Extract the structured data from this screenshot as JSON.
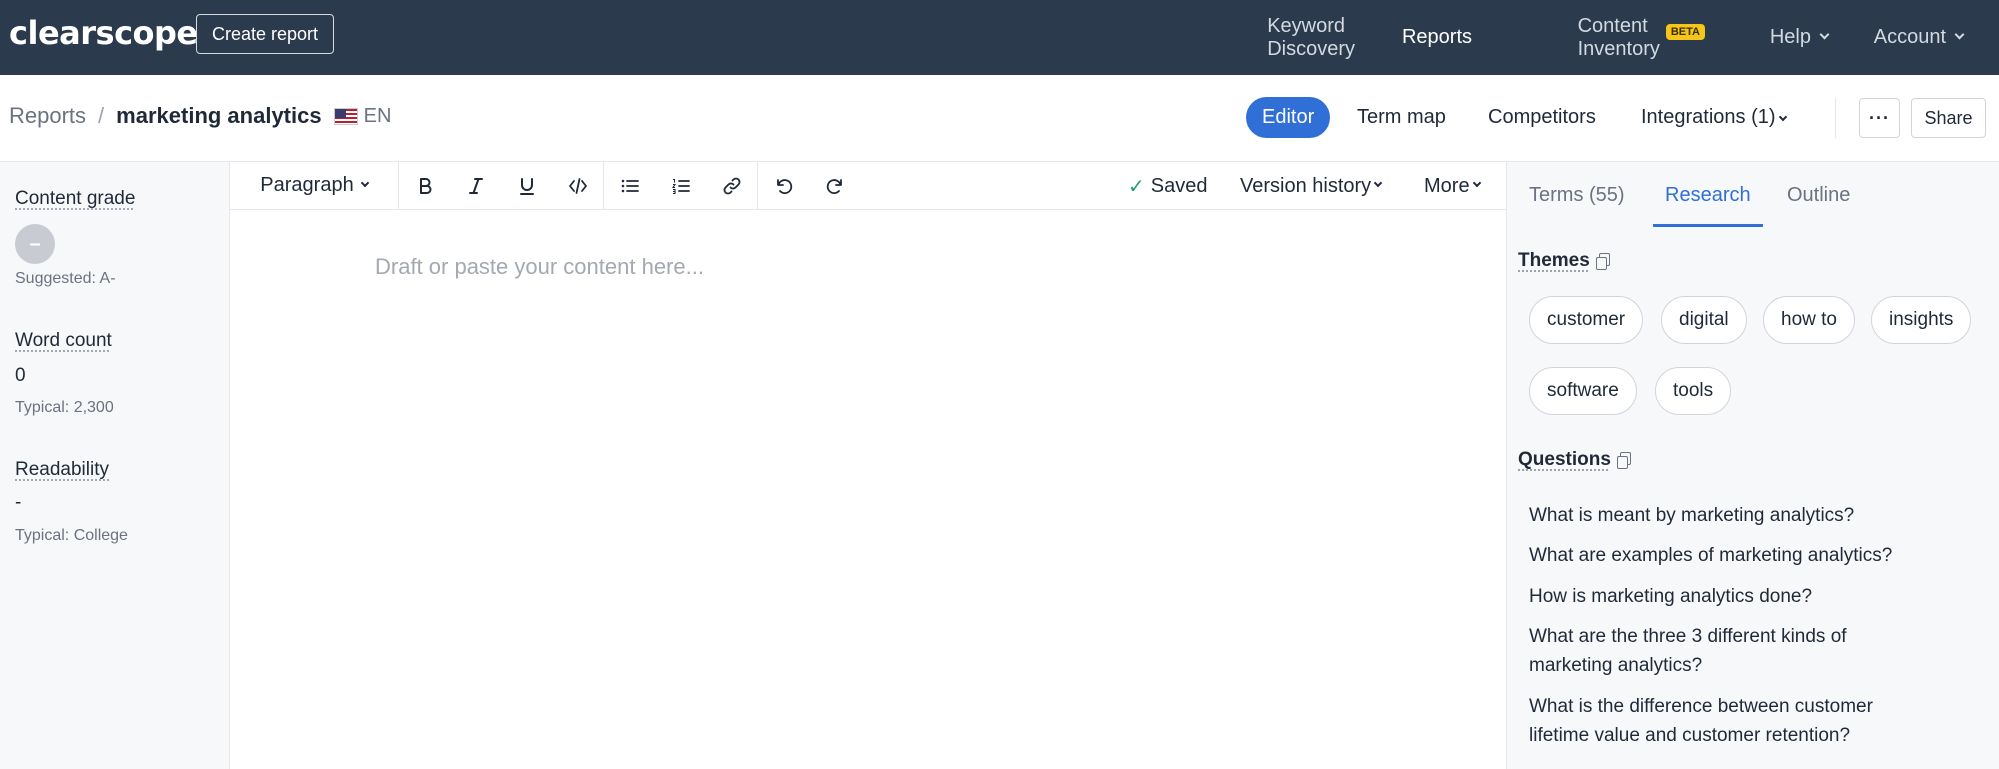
{
  "nav": {
    "logo": "clearscope",
    "create_report": "Create report",
    "links": {
      "keyword_discovery": "Keyword Discovery",
      "reports": "Reports",
      "content_inventory": "Content Inventory",
      "beta": "BETA",
      "help": "Help",
      "account": "Account"
    }
  },
  "breadcrumb": {
    "root": "Reports",
    "separator": "/",
    "current": "marketing analytics",
    "language": "EN"
  },
  "view_tabs": {
    "editor": "Editor",
    "term_map": "Term map",
    "competitors": "Competitors",
    "integrations": "Integrations (1)"
  },
  "actions": {
    "more": "···",
    "share": "Share"
  },
  "left_panel": {
    "content_grade": {
      "title": "Content grade",
      "value": "–",
      "suggested": "Suggested: A-"
    },
    "word_count": {
      "title": "Word count",
      "value": "0",
      "typical": "Typical: 2,300"
    },
    "readability": {
      "title": "Readability",
      "value": "-",
      "typical": "Typical: College"
    }
  },
  "toolbar": {
    "paragraph": "Paragraph",
    "saved": "Saved",
    "version_history": "Version history",
    "more": "More"
  },
  "editor": {
    "placeholder": "Draft or paste your content here..."
  },
  "right_panel": {
    "tabs": {
      "terms": "Terms (55)",
      "research": "Research",
      "outline": "Outline"
    },
    "themes_title": "Themes",
    "themes": [
      "customer",
      "digital",
      "how to",
      "insights",
      "software",
      "tools"
    ],
    "questions_title": "Questions",
    "questions": [
      "What is meant by marketing analytics?",
      "What are examples of marketing analytics?",
      "How is marketing analytics done?",
      "What are the three 3 different kinds of marketing analytics?",
      "What is the difference between customer lifetime value and customer retention?"
    ]
  },
  "colors": {
    "nav_bg": "#2b3a4c",
    "accent": "#2f6fd6",
    "beta_badge": "#f5c518",
    "saved_check": "#22a06b"
  }
}
